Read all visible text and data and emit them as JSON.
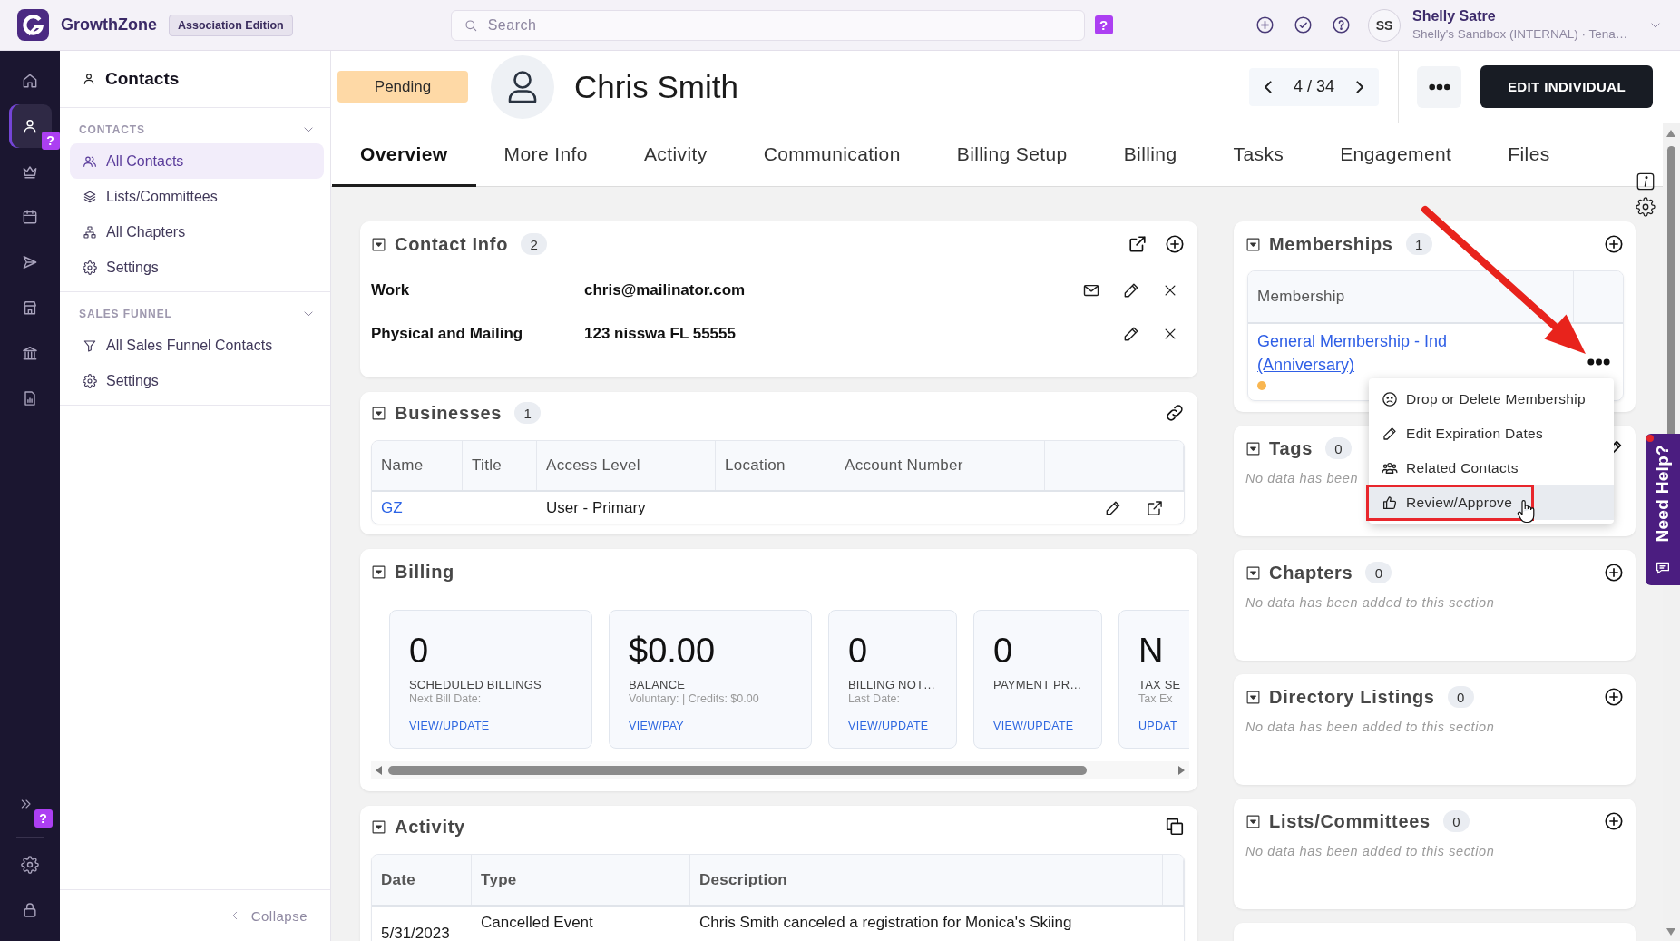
{
  "top_bar": {
    "brand": "GrowthZone",
    "edition": "Association Edition",
    "search": {
      "placeholder": "Search"
    },
    "help_badge": "?",
    "user": {
      "initials": "SS",
      "name": "Shelly Satre",
      "account": "Shelly's Sandbox (INTERNAL) · Tena…"
    }
  },
  "rail": {
    "items": [
      {
        "selected": false
      },
      {
        "selected": true,
        "badge": "?"
      },
      {
        "selected": false
      },
      {
        "selected": false
      },
      {
        "selected": false
      },
      {
        "selected": false
      },
      {
        "selected": false
      },
      {
        "selected": false
      }
    ],
    "footer_badge": "?"
  },
  "sidebar": {
    "title": "Contacts",
    "sections": [
      {
        "heading": "CONTACTS",
        "expanded": true,
        "items": [
          {
            "label": "All Contacts",
            "selected": true
          },
          {
            "label": "Lists/Committees",
            "selected": false
          },
          {
            "label": "All Chapters",
            "selected": false
          },
          {
            "label": "Settings",
            "selected": false
          }
        ]
      },
      {
        "heading": "SALES FUNNEL",
        "expanded": true,
        "items": [
          {
            "label": "All Sales Funnel Contacts",
            "selected": false
          },
          {
            "label": "Settings",
            "selected": false
          }
        ]
      }
    ],
    "collapse": "Collapse"
  },
  "record": {
    "status": "Pending",
    "name": "Chris Smith",
    "position": "4 / 34",
    "edit_button": "EDIT INDIVIDUAL"
  },
  "tabs": [
    {
      "label": "Overview",
      "selected": true
    },
    {
      "label": "More Info",
      "selected": false
    },
    {
      "label": "Activity",
      "selected": false
    },
    {
      "label": "Communication",
      "selected": false
    },
    {
      "label": "Billing Setup",
      "selected": false
    },
    {
      "label": "Billing",
      "selected": false
    },
    {
      "label": "Tasks",
      "selected": false
    },
    {
      "label": "Engagement",
      "selected": false
    },
    {
      "label": "Files",
      "selected": false
    }
  ],
  "contact_info": {
    "title": "Contact Info",
    "count": "2",
    "rows": [
      {
        "kind": "email",
        "label": "Work",
        "value": "chris@mailinator.com"
      },
      {
        "kind": "address",
        "label": "Physical and Mailing",
        "value": "123 nisswa FL 55555"
      }
    ]
  },
  "businesses": {
    "title": "Businesses",
    "count": "1",
    "columns": [
      "Name",
      "Title",
      "Access Level",
      "Location",
      "Account Number"
    ],
    "rows": [
      {
        "name": "GZ",
        "access_level": "User - Primary"
      }
    ]
  },
  "billing": {
    "title": "Billing",
    "cards": [
      {
        "value": "0",
        "label": "SCHEDULED BILLINGS",
        "detail": "Next Bill Date:",
        "link": "VIEW/UPDATE"
      },
      {
        "value": "$0.00",
        "label": "BALANCE",
        "detail": "Voluntary: | Credits: $0.00",
        "link": "VIEW/PAY"
      },
      {
        "value": "0",
        "label": "BILLING NOT…",
        "detail": "Last Date:",
        "link": "VIEW/UPDATE"
      },
      {
        "value": "0",
        "label": "PAYMENT PR…",
        "link": "VIEW/UPDATE"
      },
      {
        "value": "N",
        "label": "TAX SE",
        "detail": "Tax Ex",
        "link": "UPDAT"
      }
    ]
  },
  "activity": {
    "title": "Activity",
    "columns": [
      "Date",
      "Type",
      "Description"
    ],
    "rows": [
      {
        "date": "5/31/2023",
        "type": "Cancelled Event",
        "description": "Chris Smith canceled a registration for Monica's Skiing"
      }
    ]
  },
  "memberships": {
    "title": "Memberships",
    "count": "1",
    "columns": [
      "Membership"
    ],
    "rows": [
      {
        "name": "General Membership - Ind (Anniversary)",
        "color": "#f9b650"
      }
    ],
    "row_menu": {
      "items": [
        {
          "label": "Drop or Delete Membership",
          "selected": false,
          "outlined": false
        },
        {
          "label": "Edit Expiration Dates",
          "selected": false,
          "outlined": false
        },
        {
          "label": "Related Contacts",
          "selected": false,
          "outlined": false
        },
        {
          "label": "Review/Approve",
          "selected": true,
          "outlined": true
        }
      ]
    }
  },
  "side_sections": [
    {
      "kind": "edit",
      "title": "Tags",
      "count": "0",
      "message": "No data has been"
    },
    {
      "kind": "add",
      "title": "Chapters",
      "count": "0",
      "message": "No data has been added to this section"
    },
    {
      "kind": "add",
      "title": "Directory Listings",
      "count": "0",
      "message": "No data has been added to this section"
    },
    {
      "kind": "add",
      "title": "Lists/Committees",
      "count": "0",
      "message": "No data has been added to this section"
    }
  ],
  "help_tab": {
    "label": "Need Help?"
  }
}
